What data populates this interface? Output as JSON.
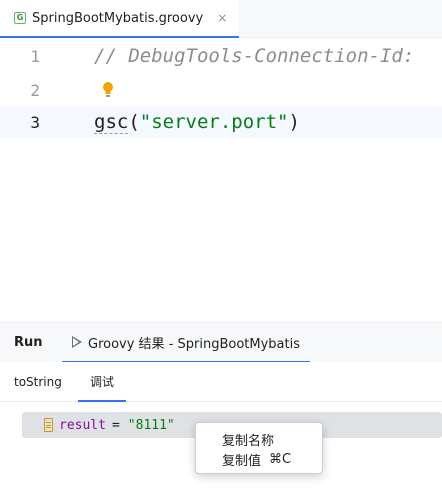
{
  "editor_tab": {
    "file_icon_letter": "G",
    "label": "SpringBootMybatis.groovy",
    "close_glyph": "×"
  },
  "editor": {
    "lines": [
      {
        "number": "1",
        "comment": "// DebugTools-Connection-Id:"
      },
      {
        "number": "2"
      },
      {
        "number": "3",
        "fn": "gsc",
        "open": "(",
        "string": "\"server.port\"",
        "close": ")"
      }
    ]
  },
  "run_panel": {
    "title": "Run",
    "tab_label": "Groovy 结果 - SpringBootMybatis",
    "subtabs": [
      "toString",
      "调试"
    ],
    "result": {
      "name": "result",
      "eq": "=",
      "value": "\"8111\""
    }
  },
  "context_menu": {
    "items": [
      {
        "label": "复制名称"
      },
      {
        "label": "复制值",
        "shortcut": "⌘C"
      }
    ]
  },
  "colors": {
    "accent": "#3574f0",
    "string": "#067d17",
    "comment": "#8c8c8c",
    "bulb": "#f0a30a"
  }
}
